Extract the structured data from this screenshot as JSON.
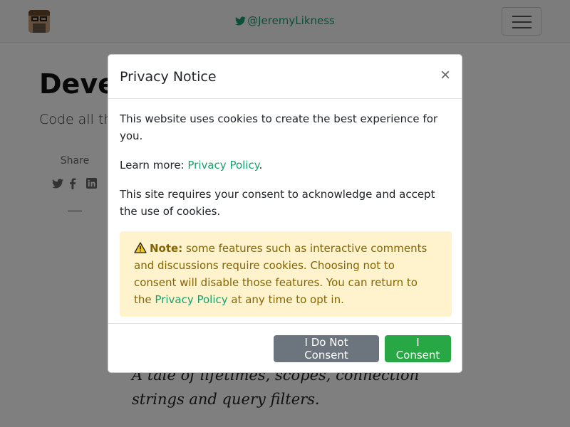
{
  "navbar": {
    "twitter_handle": "@JeremyLikness"
  },
  "page": {
    "title": "Devel",
    "subtitle": "Code all the",
    "share_label": "Share",
    "intro_quote": "A tale of lifetimes, scopes, connection strings and query filters."
  },
  "modal": {
    "title": "Privacy Notice",
    "close_label": "×",
    "p1": "This website uses cookies to create the best experience for you.",
    "p2_prefix": "Learn more: ",
    "privacy_link": "Privacy Policy",
    "p2_suffix": ".",
    "p3": "This site requires your consent to acknowledge and accept the use of cookies.",
    "alert": {
      "strong": "Note:",
      "text": " some features such as interactive comments and discussions require cookies. Choosing not to consent will disable those features. You can return to the ",
      "link": "Privacy Policy",
      "suffix": " at any time to opt in."
    },
    "decline_button": "I Do Not Consent",
    "consent_button": "I Consent"
  },
  "colors": {
    "accent": "#1a9f6c",
    "consent": "#28a745",
    "decline": "#6c757d",
    "alert_bg": "#fff3cd",
    "alert_text": "#856404"
  },
  "icons": [
    "avatar",
    "twitter-icon",
    "hamburger-icon",
    "share-twitter-icon",
    "share-facebook-icon",
    "share-linkedin-icon",
    "close-icon",
    "warning-icon"
  ]
}
